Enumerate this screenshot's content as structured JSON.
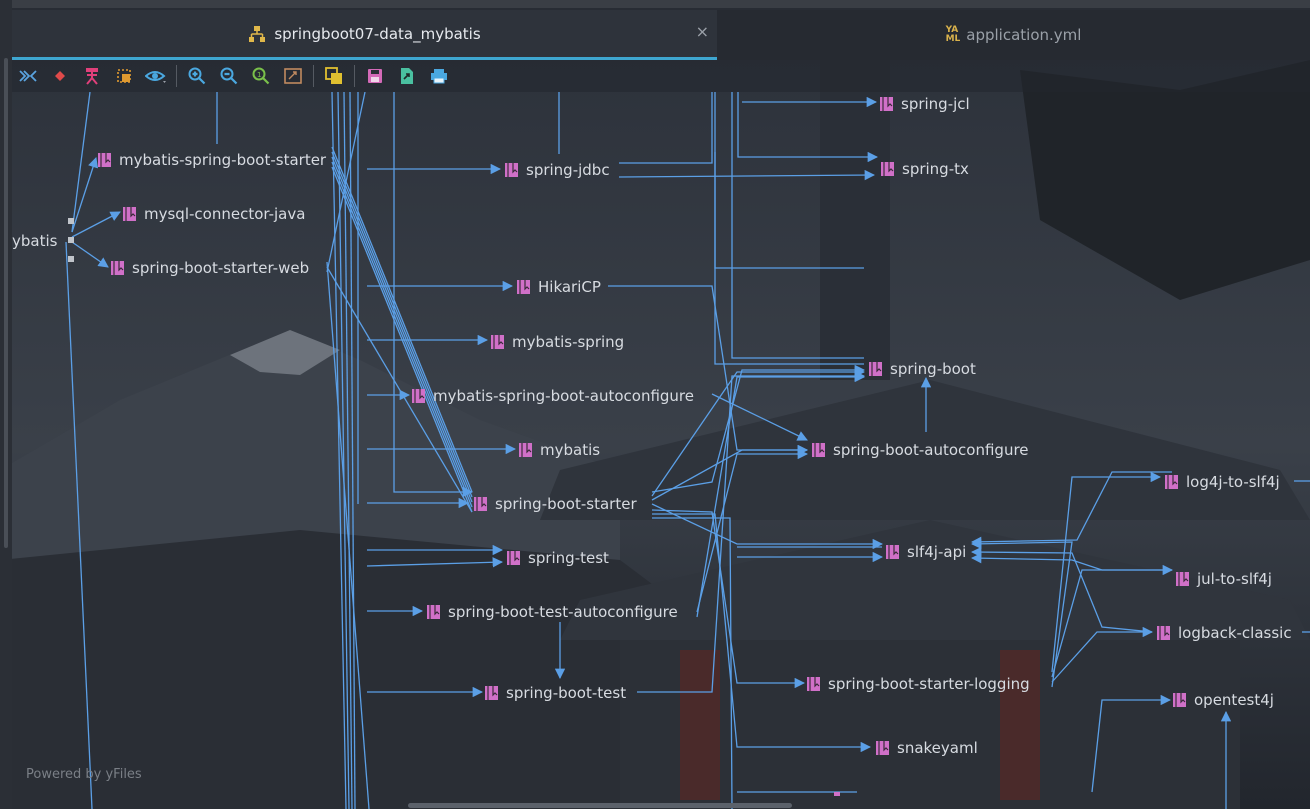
{
  "tabs": [
    {
      "label": "springboot07-data_mybatis",
      "active": true,
      "icon": "hierarchy-icon"
    },
    {
      "label": "application.yml",
      "active": false,
      "icon": "yaml-file-icon",
      "icon_text": "YAML"
    }
  ],
  "toolbar": {
    "buttons": [
      {
        "name": "expand-collapse-icon",
        "glyph": "»«",
        "color": "#5aa4e0"
      },
      {
        "name": "diamond-icon",
        "glyph": "◆",
        "color": "#e04a4a"
      },
      {
        "name": "actor-icon",
        "glyph": "⚲",
        "color": "#e0407a"
      },
      {
        "name": "select-dashed-icon",
        "glyph": "⬚",
        "color": "#e09a30"
      },
      {
        "name": "eye-icon",
        "glyph": "👁",
        "color": "#4aa8e0"
      },
      {
        "name": "zoom-in-icon",
        "glyph": "+",
        "color": "#4aa8e0"
      },
      {
        "name": "zoom-out-icon",
        "glyph": "−",
        "color": "#4aa8e0"
      },
      {
        "name": "actual-size-icon",
        "glyph": "1",
        "color": "#7ac04a"
      },
      {
        "name": "fit-content-icon",
        "glyph": "▭",
        "color": "#c08a60"
      },
      {
        "name": "layers-icon",
        "glyph": "❐",
        "color": "#e0c030"
      },
      {
        "name": "save-icon",
        "glyph": "▪",
        "color": "#d46ab8"
      },
      {
        "name": "export-icon",
        "glyph": "⇲",
        "color": "#4ac0a0"
      },
      {
        "name": "print-icon",
        "glyph": "⎙",
        "color": "#4aa8e0"
      }
    ]
  },
  "graph": {
    "root_label": "ybatis",
    "nodes": {
      "mybatis_spring_boot_starter": "mybatis-spring-boot-starter",
      "mysql_connector_java": "mysql-connector-java",
      "spring_boot_starter_web": "spring-boot-starter-web",
      "spring_jdbc": "spring-jdbc",
      "hikaricp": "HikariCP",
      "mybatis_spring": "mybatis-spring",
      "mybatis_spring_boot_autoconfigure": "mybatis-spring-boot-autoconfigure",
      "mybatis": "mybatis",
      "spring_boot_starter": "spring-boot-starter",
      "spring_test": "spring-test",
      "spring_boot_test_autoconfigure": "spring-boot-test-autoconfigure",
      "spring_boot_test": "spring-boot-test",
      "spring_jcl": "spring-jcl",
      "spring_tx": "spring-tx",
      "spring_boot": "spring-boot",
      "spring_boot_autoconfigure": "spring-boot-autoconfigure",
      "slf4j_api": "slf4j-api",
      "spring_boot_starter_logging": "spring-boot-starter-logging",
      "snakeyaml": "snakeyaml",
      "log4j_to_slf4j": "log4j-to-slf4j",
      "jul_to_slf4j": "jul-to-slf4j",
      "logback_classic": "logback-classic",
      "opentest4j": "opentest4j"
    },
    "edge_color": "#5b9fe6",
    "node_icon_color": "#d070c8"
  },
  "footer": {
    "powered_by": "Powered by yFiles"
  }
}
